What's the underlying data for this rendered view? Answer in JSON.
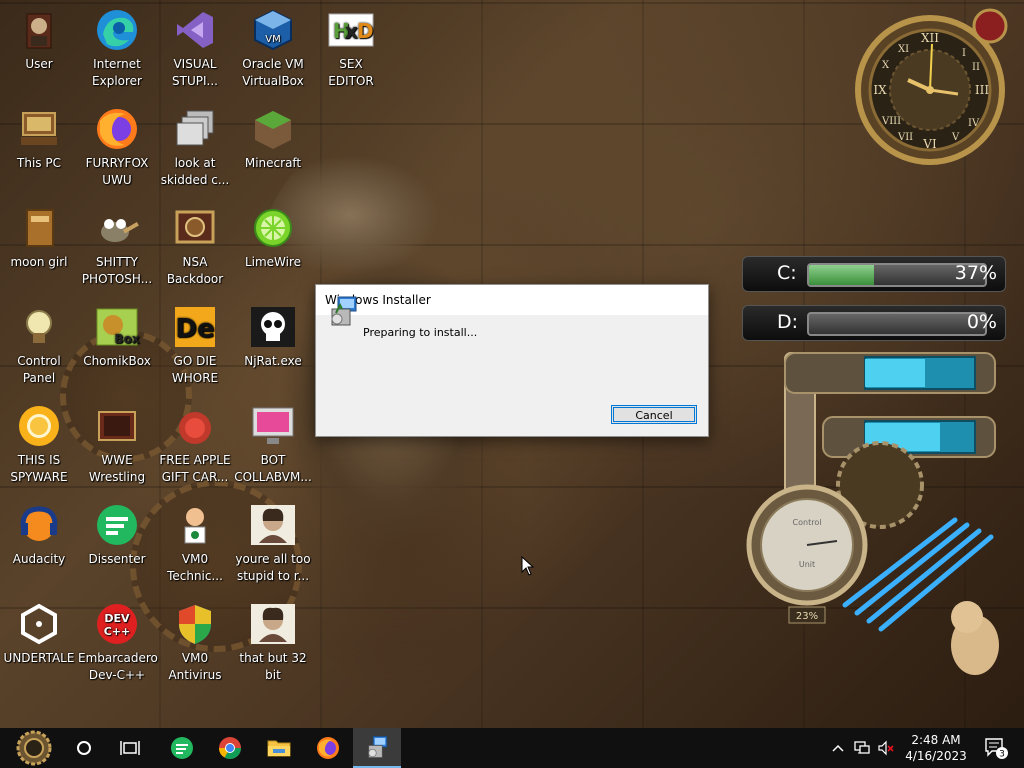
{
  "desktop": {
    "icons": [
      {
        "label": "User",
        "icon": "user-folder-icon"
      },
      {
        "label": "Internet\nExplorer",
        "icon": "edge-icon"
      },
      {
        "label": "VISUAL\nSTUPI...",
        "icon": "visual-studio-icon"
      },
      {
        "label": "Oracle VM\nVirtualBox",
        "icon": "virtualbox-icon"
      },
      {
        "label": "SEX\nEDITOR",
        "icon": "hex-editor-icon"
      },
      {
        "label": "This PC",
        "icon": "this-pc-icon"
      },
      {
        "label": "FURRYFOX\nUWU",
        "icon": "firefox-icon"
      },
      {
        "label": "look at\nskidded c...",
        "icon": "windows-copy-icon"
      },
      {
        "label": "Minecraft",
        "icon": "minecraft-icon"
      },
      {
        "label": "moon girl",
        "icon": "book-icon"
      },
      {
        "label": "SHITTY\nPHOTOSH...",
        "icon": "gimp-icon"
      },
      {
        "label": "NSA\nBackdoor",
        "icon": "nsa-backdoor-icon"
      },
      {
        "label": "LimeWire",
        "icon": "limewire-icon"
      },
      {
        "label": "Control Panel",
        "icon": "control-panel-icon"
      },
      {
        "label": "ChomikBox",
        "icon": "chomikbox-icon"
      },
      {
        "label": "GO DIE\nWHORE",
        "icon": "de-app-icon"
      },
      {
        "label": "NjRat.exe",
        "icon": "skull-icon"
      },
      {
        "label": "THIS IS\nSPYWARE",
        "icon": "chrome-canary-icon"
      },
      {
        "label": "WWE\nWrestling",
        "icon": "tv-icon"
      },
      {
        "label": "FREE APPLE\nGIFT CAR...",
        "icon": "apple-gift-icon"
      },
      {
        "label": "BOT\nCOLLABVM...",
        "icon": "monitor-icon"
      },
      {
        "label": "Audacity",
        "icon": "audacity-icon"
      },
      {
        "label": "Dissenter",
        "icon": "dissenter-icon"
      },
      {
        "label": "VM0\nTechnic...",
        "icon": "technician-icon"
      },
      {
        "label": "youre all too\nstupid to r...",
        "icon": "portrait-icon"
      },
      {
        "label": "UNDERTALE",
        "icon": "unity-icon"
      },
      {
        "label": "Embarcadero\nDev-C++",
        "icon": "devcpp-icon"
      },
      {
        "label": "VM0\nAntivirus",
        "icon": "shield-icon"
      },
      {
        "label": "that but 32\nbit",
        "icon": "portrait-icon"
      }
    ]
  },
  "widgets": {
    "drives": [
      {
        "label": "C:",
        "percent": "37%",
        "fill": 0.37
      },
      {
        "label": "D:",
        "percent": "0%",
        "fill": 0.0
      }
    ],
    "gauge_value": "23%"
  },
  "dialog": {
    "title": "Windows Installer",
    "message": "Preparing to install...",
    "cancel_label": "Cancel"
  },
  "taskbar": {
    "clock_time": "2:48 AM",
    "clock_date": "4/16/2023",
    "notification_count": "3",
    "accent": "#76b9ed"
  }
}
